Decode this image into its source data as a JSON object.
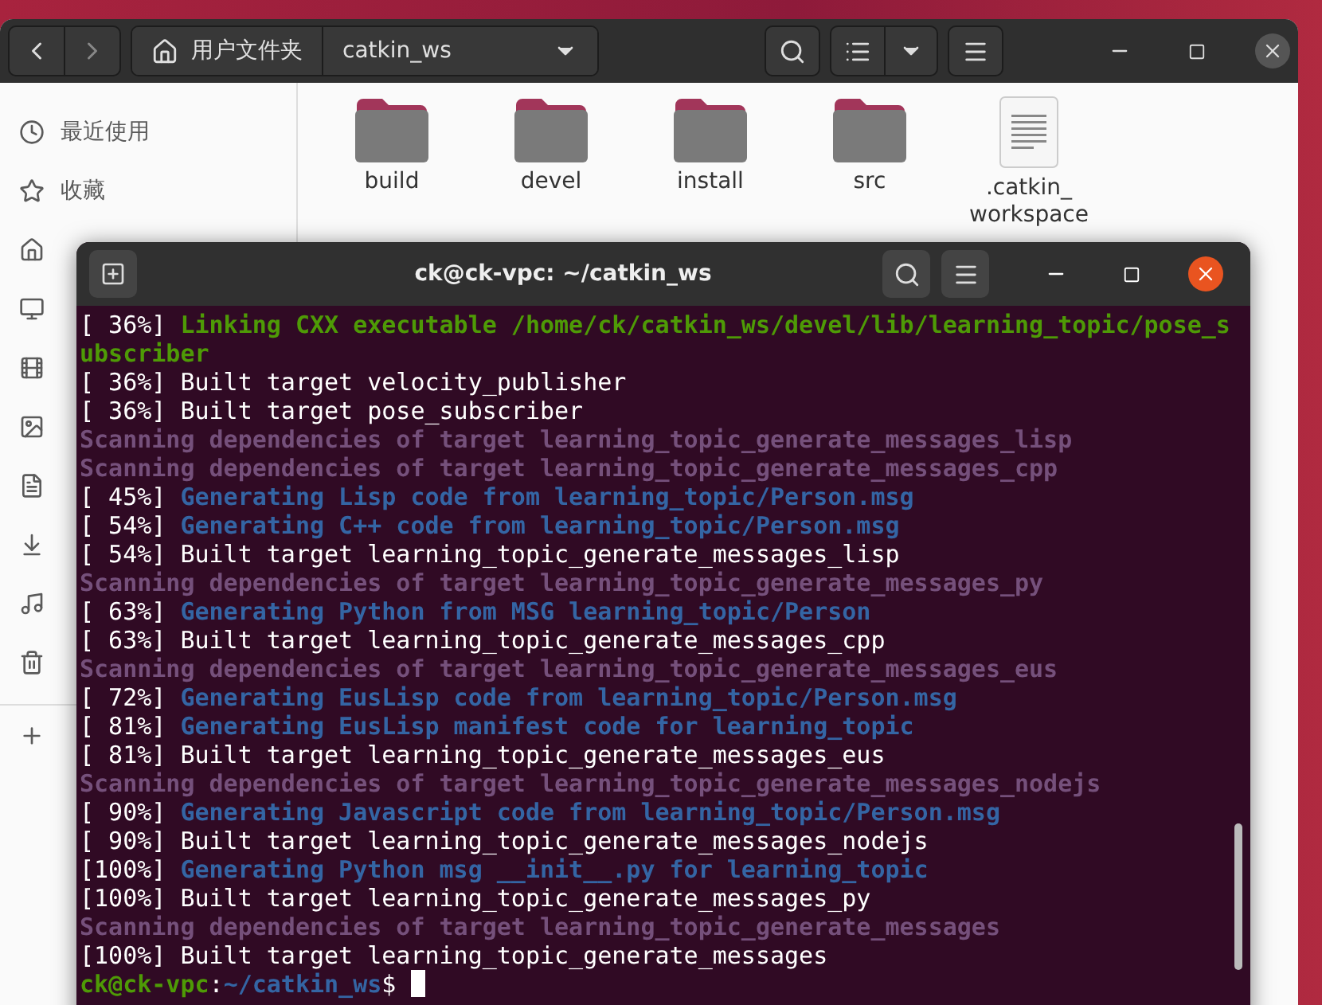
{
  "file_manager": {
    "path": [
      {
        "label": "用户文件夹",
        "kind": "home"
      },
      {
        "label": "catkin_ws",
        "kind": "current"
      }
    ],
    "sidebar": {
      "items": [
        {
          "label": "最近使用"
        },
        {
          "label": "收藏"
        }
      ]
    },
    "files": [
      {
        "name": "build",
        "kind": "folder"
      },
      {
        "name": "devel",
        "kind": "folder"
      },
      {
        "name": "install",
        "kind": "folder"
      },
      {
        "name": "src",
        "kind": "folder"
      },
      {
        "name": ".catkin_ workspace",
        "kind": "text"
      }
    ]
  },
  "terminal": {
    "title": "ck@ck-vpc: ~/catkin_ws",
    "lines": [
      {
        "prefix": "[ 36%] ",
        "text": "Linking CXX executable /home/ck/catkin_ws/devel/lib/learning_topic/pose_subscriber",
        "kind": "link"
      },
      {
        "prefix": "[ 36%] ",
        "text": "Built target velocity_publisher",
        "kind": "built"
      },
      {
        "prefix": "[ 36%] ",
        "text": "Built target pose_subscriber",
        "kind": "built"
      },
      {
        "text": "Scanning dependencies of target learning_topic_generate_messages_lisp",
        "kind": "scan"
      },
      {
        "text": "Scanning dependencies of target learning_topic_generate_messages_cpp",
        "kind": "scan"
      },
      {
        "prefix": "[ 45%] ",
        "text": "Generating Lisp code from learning_topic/Person.msg",
        "kind": "gen"
      },
      {
        "prefix": "[ 54%] ",
        "text": "Generating C++ code from learning_topic/Person.msg",
        "kind": "gen"
      },
      {
        "prefix": "[ 54%] ",
        "text": "Built target learning_topic_generate_messages_lisp",
        "kind": "built"
      },
      {
        "text": "Scanning dependencies of target learning_topic_generate_messages_py",
        "kind": "scan"
      },
      {
        "prefix": "[ 63%] ",
        "text": "Generating Python from MSG learning_topic/Person",
        "kind": "gen"
      },
      {
        "prefix": "[ 63%] ",
        "text": "Built target learning_topic_generate_messages_cpp",
        "kind": "built"
      },
      {
        "text": "Scanning dependencies of target learning_topic_generate_messages_eus",
        "kind": "scan"
      },
      {
        "prefix": "[ 72%] ",
        "text": "Generating EusLisp code from learning_topic/Person.msg",
        "kind": "gen"
      },
      {
        "prefix": "[ 81%] ",
        "text": "Generating EusLisp manifest code for learning_topic",
        "kind": "gen"
      },
      {
        "prefix": "[ 81%] ",
        "text": "Built target learning_topic_generate_messages_eus",
        "kind": "built"
      },
      {
        "text": "Scanning dependencies of target learning_topic_generate_messages_nodejs",
        "kind": "scan"
      },
      {
        "prefix": "[ 90%] ",
        "text": "Generating Javascript code from learning_topic/Person.msg",
        "kind": "gen"
      },
      {
        "prefix": "[ 90%] ",
        "text": "Built target learning_topic_generate_messages_nodejs",
        "kind": "built"
      },
      {
        "prefix": "[100%] ",
        "text": "Generating Python msg __init__.py for learning_topic",
        "kind": "gen"
      },
      {
        "prefix": "[100%] ",
        "text": "Built target learning_topic_generate_messages_py",
        "kind": "built"
      },
      {
        "text": "Scanning dependencies of target learning_topic_generate_messages",
        "kind": "scan"
      },
      {
        "prefix": "[100%] ",
        "text": "Built target learning_topic_generate_messages",
        "kind": "built"
      }
    ],
    "prompt": {
      "user": "ck@ck-vpc",
      "sep": ":",
      "path": "~/catkin_ws",
      "symbol": "$"
    }
  }
}
